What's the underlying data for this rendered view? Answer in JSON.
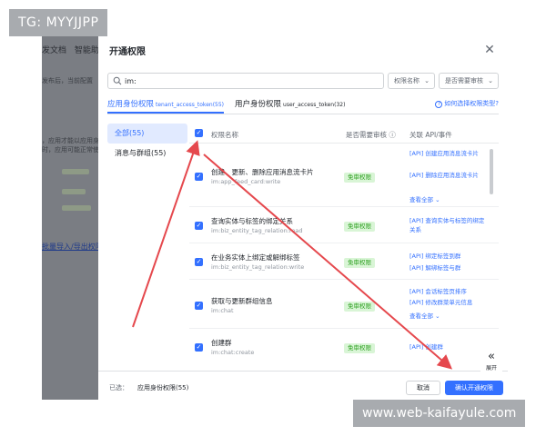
{
  "watermark": {
    "top_left": "TG: MYYJJPP",
    "bottom_right": "www.web-kaifayule.com"
  },
  "background_page": {
    "tabs": [
      "发文档",
      "智能助"
    ],
    "lines": [
      "发布后，当前配置",
      "，应用才能以应用身",
      "时，应用可能正常使用"
    ],
    "link": "批量导入/导出权限"
  },
  "modal": {
    "title": "开通权限",
    "search": {
      "value": "im:"
    },
    "filter_name": "权限名称",
    "filter_review": "是否需要审核",
    "tabs": [
      {
        "label": "应用身份权限",
        "sub": "tenant_access_token(55)"
      },
      {
        "label": "用户身份权限",
        "sub": "user_access_token(32)"
      }
    ],
    "help_link": "如何选择权限类型?",
    "sidebar": [
      {
        "label": "全部(55)"
      },
      {
        "label": "消息与群组(55)"
      }
    ],
    "columns": {
      "name": "权限名称",
      "review": "是否需要审核",
      "api": "关联 API/事件"
    },
    "rows": [
      {
        "name": "创建、更新、删除应用消息流卡片",
        "key": "im:app_feed_card:write",
        "badge": "免审权限",
        "apis": [
          "[API] 创建应用消息流卡片",
          "[API] 删除应用消息流卡片"
        ],
        "more": "查看全部"
      },
      {
        "name": "查询实体与标签的绑定关系",
        "key": "im:biz_entity_tag_relation:read",
        "badge": "免审权限",
        "apis": [
          "[API] 查询实体与标签的绑定关系"
        ],
        "more": ""
      },
      {
        "name": "在业务实体上绑定或解绑标签",
        "key": "im:biz_entity_tag_relation:write",
        "badge": "免审权限",
        "apis": [
          "[API] 绑定标签到群",
          "[API] 解绑标签与群"
        ],
        "more": ""
      },
      {
        "name": "获取与更新群组信息",
        "key": "im:chat",
        "badge": "免审权限",
        "apis": [
          "[API] 会话标签页排序",
          "[API] 修改群菜单元信息"
        ],
        "more": "查看全部"
      },
      {
        "name": "创建群",
        "key": "im:chat:create",
        "badge": "免审权限",
        "apis": [
          "[API] 创建群"
        ],
        "more": ""
      }
    ],
    "expand_label": "展开",
    "footer": {
      "selected_label": "已选：",
      "selected_value": "应用身份权限(55)",
      "cancel": "取消",
      "confirm": "确认开通权限"
    }
  },
  "colors": {
    "accent": "#3370ff",
    "badge_bg": "#d9f5d6",
    "badge_text": "#2ea121",
    "annotation_arrow": "#e5484d"
  }
}
